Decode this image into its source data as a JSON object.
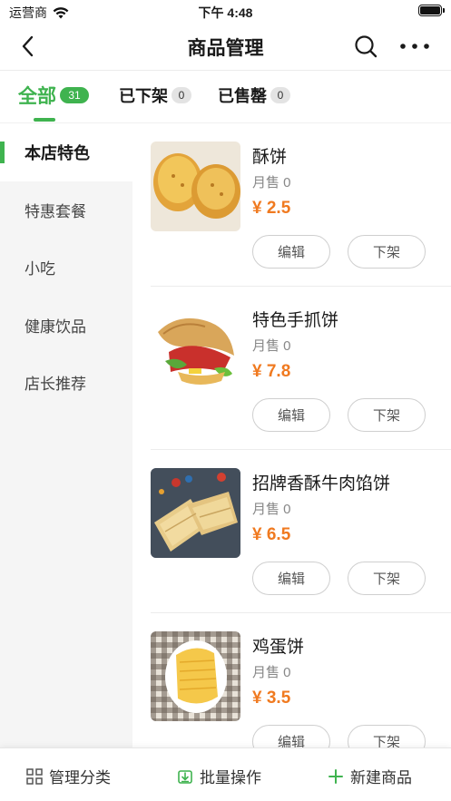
{
  "status_bar": {
    "carrier": "运营商",
    "time": "下午 4:48"
  },
  "nav": {
    "title": "商品管理"
  },
  "tabs": [
    {
      "label": "全部",
      "count": "31"
    },
    {
      "label": "已下架",
      "count": "0"
    },
    {
      "label": "已售罄",
      "count": "0"
    }
  ],
  "categories": [
    "本店特色",
    "特惠套餐",
    "小吃",
    "健康饮品",
    "店长推荐"
  ],
  "products": [
    {
      "name": "酥饼",
      "sales_label": "月售 0",
      "price": "¥ 2.5",
      "edit_label": "编辑",
      "off_label": "下架",
      "image": "pastry"
    },
    {
      "name": "特色手抓饼",
      "sales_label": "月售 0",
      "price": "¥ 7.8",
      "edit_label": "编辑",
      "off_label": "下架",
      "image": "wrap"
    },
    {
      "name": "招牌香酥牛肉馅饼",
      "sales_label": "月售 0",
      "price": "¥ 6.5",
      "edit_label": "编辑",
      "off_label": "下架",
      "image": "meat-pie"
    },
    {
      "name": "鸡蛋饼",
      "sales_label": "月售 0",
      "price": "¥ 3.5",
      "edit_label": "编辑",
      "off_label": "下架",
      "image": "egg-pancake"
    }
  ],
  "bottom_bar": {
    "manage_categories": "管理分类",
    "batch_operations": "批量操作",
    "new_product": "新建商品"
  },
  "colors": {
    "accent": "#3fb34f",
    "price": "#f07a20"
  },
  "icons": [
    "back-arrow-icon",
    "search-icon",
    "more-icon",
    "grid-icon",
    "batch-icon",
    "plus-icon",
    "wifi-icon",
    "battery-icon"
  ]
}
